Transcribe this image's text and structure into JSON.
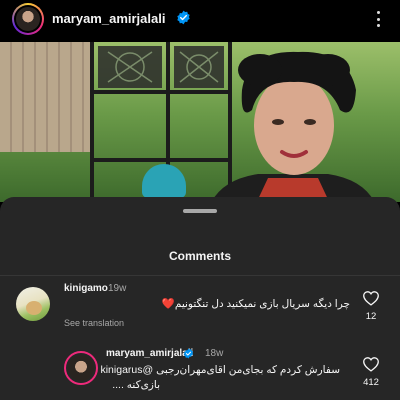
{
  "header": {
    "username": "maryam_amirjalali",
    "verified_icon": "verified-badge-icon",
    "more_icon": "more-options-icon"
  },
  "sheet": {
    "title": "Comments"
  },
  "comments": [
    {
      "username": "kinigamo",
      "time": "19w",
      "text": "چرا دیگه سریال بازی نمیکنید دل تنگتونیم❤️",
      "link": "See translation",
      "likes": "12",
      "verified": false
    },
    {
      "username": "maryam_amirjalali",
      "time": "18w",
      "text_line1": "سفارش کردم که بجای‌من اقای‌مهران‌رجبی @kinigarus",
      "text_line2": "بازی‌کنه ....",
      "likes": "412",
      "verified": true
    }
  ],
  "colors": {
    "background": "#000000",
    "sheet": "#262626",
    "secondary_text": "#a8a8a8",
    "verified_blue": "#0095f6"
  }
}
